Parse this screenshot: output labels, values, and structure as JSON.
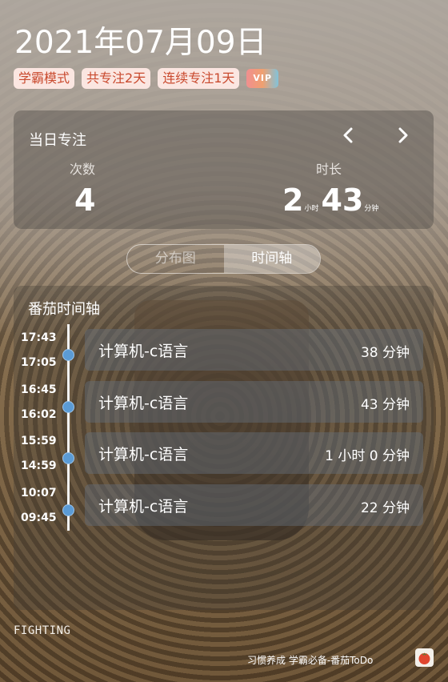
{
  "header": {
    "date": "2021年07月09日",
    "tags": [
      "学霸模式",
      "共专注2天",
      "连续专注1天"
    ],
    "vip": "VIP"
  },
  "daily": {
    "title": "当日专注",
    "count_label": "次数",
    "count": "4",
    "duration_label": "时长",
    "hours": "2",
    "hours_unit": "小时",
    "minutes": "43",
    "minutes_unit": "分钟"
  },
  "tabs": [
    "分布图",
    "时间轴"
  ],
  "active_tab": "时间轴",
  "timeline": {
    "title": "番茄时间轴",
    "entries": [
      {
        "end": "17:43",
        "start": "17:05",
        "task": "计算机-c语言",
        "duration": "38 分钟"
      },
      {
        "end": "16:45",
        "start": "16:02",
        "task": "计算机-c语言",
        "duration": "43 分钟"
      },
      {
        "end": "15:59",
        "start": "14:59",
        "task": "计算机-c语言",
        "duration": "1 小时 0 分钟"
      },
      {
        "end": "10:07",
        "start": "09:45",
        "task": "计算机-c语言",
        "duration": "22 分钟"
      }
    ]
  },
  "footer": {
    "motto": "FIGHTING",
    "slogan": "习惯养成 学霸必备-番茄ToDo",
    "logo_icon": "tomato-icon"
  },
  "colors": {
    "tag_text": "#c94a2e",
    "tag_bg": "#fbe6e1",
    "timeline_dot": "#5b9bd5"
  }
}
